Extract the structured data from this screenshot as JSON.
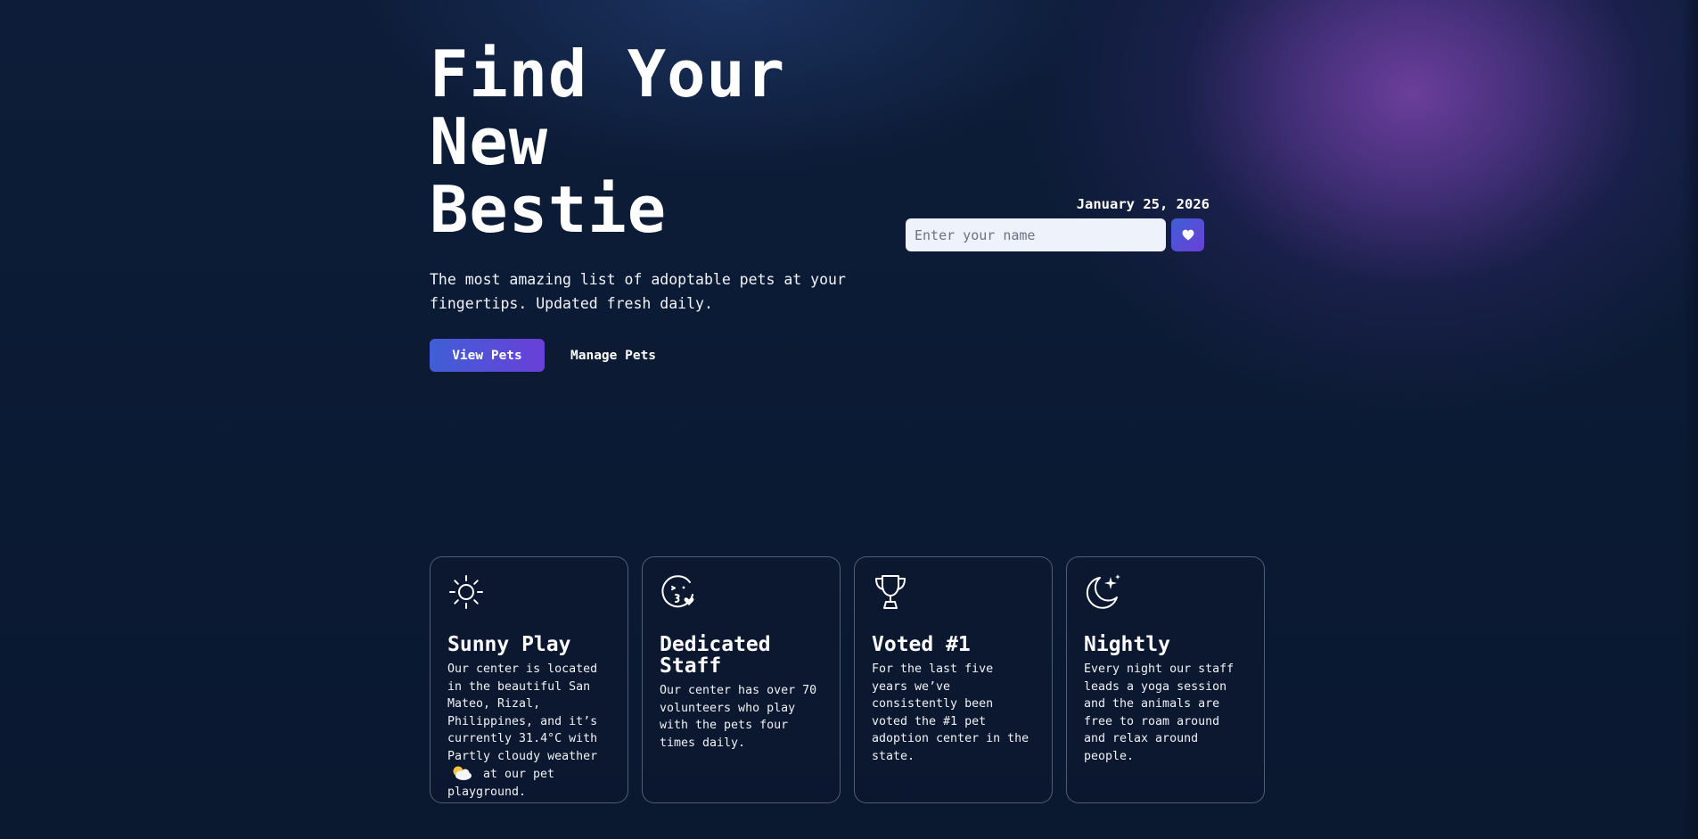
{
  "hero": {
    "title_line1": "Find Your",
    "title_line2": "New",
    "title_line3": "Bestie",
    "subtitle": "The most amazing list of adoptable pets at your fingertips. Updated fresh daily."
  },
  "actions": {
    "view_pets": "View Pets",
    "manage_pets": "Manage Pets"
  },
  "greeting": {
    "date": "January 25, 2026",
    "name_placeholder": "Enter your name",
    "submit_icon": "heart-icon"
  },
  "features": [
    {
      "icon": "sun-icon",
      "title": "Sunny Play",
      "text_before": "Our center is located in the beautiful San Mateo, Rizal, Philippines, and it’s currently 31.4°C with Partly cloudy weather",
      "weather_icon": "partly-cloudy-icon",
      "text_after": "at our pet playground."
    },
    {
      "icon": "kiss-face-icon",
      "title": "Dedicated Staff",
      "text": "Our center has over 70 volunteers who play with the pets four times daily."
    },
    {
      "icon": "trophy-icon",
      "title": "Voted #1",
      "text": "For the last five years we’ve consistently been voted the #1 pet adoption center in the state."
    },
    {
      "icon": "moon-stars-icon",
      "title": "Nightly",
      "text": "Every night our staff leads a yoga session and the animals are free to roam around and relax around people."
    }
  ],
  "colors": {
    "background": "#0c1a33",
    "accent_start": "#3f5fd6",
    "accent_end": "#6a3fd8",
    "glow": "#7040a0",
    "input_bg": "#eef3fb"
  }
}
